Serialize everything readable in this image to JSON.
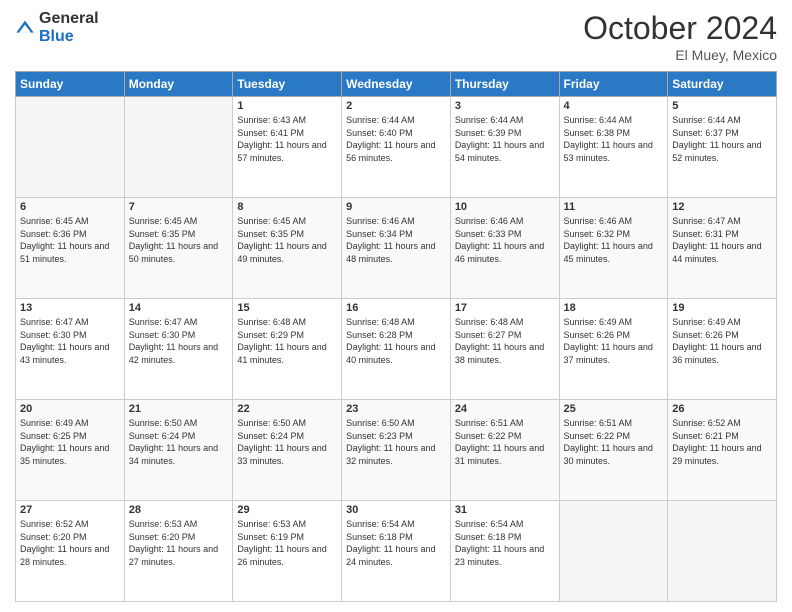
{
  "header": {
    "logo_general": "General",
    "logo_blue": "Blue",
    "month_title": "October 2024",
    "location": "El Muey, Mexico"
  },
  "days_of_week": [
    "Sunday",
    "Monday",
    "Tuesday",
    "Wednesday",
    "Thursday",
    "Friday",
    "Saturday"
  ],
  "weeks": [
    [
      {
        "num": "",
        "sunrise": "",
        "sunset": "",
        "daylight": ""
      },
      {
        "num": "",
        "sunrise": "",
        "sunset": "",
        "daylight": ""
      },
      {
        "num": "1",
        "sunrise": "Sunrise: 6:43 AM",
        "sunset": "Sunset: 6:41 PM",
        "daylight": "Daylight: 11 hours and 57 minutes."
      },
      {
        "num": "2",
        "sunrise": "Sunrise: 6:44 AM",
        "sunset": "Sunset: 6:40 PM",
        "daylight": "Daylight: 11 hours and 56 minutes."
      },
      {
        "num": "3",
        "sunrise": "Sunrise: 6:44 AM",
        "sunset": "Sunset: 6:39 PM",
        "daylight": "Daylight: 11 hours and 54 minutes."
      },
      {
        "num": "4",
        "sunrise": "Sunrise: 6:44 AM",
        "sunset": "Sunset: 6:38 PM",
        "daylight": "Daylight: 11 hours and 53 minutes."
      },
      {
        "num": "5",
        "sunrise": "Sunrise: 6:44 AM",
        "sunset": "Sunset: 6:37 PM",
        "daylight": "Daylight: 11 hours and 52 minutes."
      }
    ],
    [
      {
        "num": "6",
        "sunrise": "Sunrise: 6:45 AM",
        "sunset": "Sunset: 6:36 PM",
        "daylight": "Daylight: 11 hours and 51 minutes."
      },
      {
        "num": "7",
        "sunrise": "Sunrise: 6:45 AM",
        "sunset": "Sunset: 6:35 PM",
        "daylight": "Daylight: 11 hours and 50 minutes."
      },
      {
        "num": "8",
        "sunrise": "Sunrise: 6:45 AM",
        "sunset": "Sunset: 6:35 PM",
        "daylight": "Daylight: 11 hours and 49 minutes."
      },
      {
        "num": "9",
        "sunrise": "Sunrise: 6:46 AM",
        "sunset": "Sunset: 6:34 PM",
        "daylight": "Daylight: 11 hours and 48 minutes."
      },
      {
        "num": "10",
        "sunrise": "Sunrise: 6:46 AM",
        "sunset": "Sunset: 6:33 PM",
        "daylight": "Daylight: 11 hours and 46 minutes."
      },
      {
        "num": "11",
        "sunrise": "Sunrise: 6:46 AM",
        "sunset": "Sunset: 6:32 PM",
        "daylight": "Daylight: 11 hours and 45 minutes."
      },
      {
        "num": "12",
        "sunrise": "Sunrise: 6:47 AM",
        "sunset": "Sunset: 6:31 PM",
        "daylight": "Daylight: 11 hours and 44 minutes."
      }
    ],
    [
      {
        "num": "13",
        "sunrise": "Sunrise: 6:47 AM",
        "sunset": "Sunset: 6:30 PM",
        "daylight": "Daylight: 11 hours and 43 minutes."
      },
      {
        "num": "14",
        "sunrise": "Sunrise: 6:47 AM",
        "sunset": "Sunset: 6:30 PM",
        "daylight": "Daylight: 11 hours and 42 minutes."
      },
      {
        "num": "15",
        "sunrise": "Sunrise: 6:48 AM",
        "sunset": "Sunset: 6:29 PM",
        "daylight": "Daylight: 11 hours and 41 minutes."
      },
      {
        "num": "16",
        "sunrise": "Sunrise: 6:48 AM",
        "sunset": "Sunset: 6:28 PM",
        "daylight": "Daylight: 11 hours and 40 minutes."
      },
      {
        "num": "17",
        "sunrise": "Sunrise: 6:48 AM",
        "sunset": "Sunset: 6:27 PM",
        "daylight": "Daylight: 11 hours and 38 minutes."
      },
      {
        "num": "18",
        "sunrise": "Sunrise: 6:49 AM",
        "sunset": "Sunset: 6:26 PM",
        "daylight": "Daylight: 11 hours and 37 minutes."
      },
      {
        "num": "19",
        "sunrise": "Sunrise: 6:49 AM",
        "sunset": "Sunset: 6:26 PM",
        "daylight": "Daylight: 11 hours and 36 minutes."
      }
    ],
    [
      {
        "num": "20",
        "sunrise": "Sunrise: 6:49 AM",
        "sunset": "Sunset: 6:25 PM",
        "daylight": "Daylight: 11 hours and 35 minutes."
      },
      {
        "num": "21",
        "sunrise": "Sunrise: 6:50 AM",
        "sunset": "Sunset: 6:24 PM",
        "daylight": "Daylight: 11 hours and 34 minutes."
      },
      {
        "num": "22",
        "sunrise": "Sunrise: 6:50 AM",
        "sunset": "Sunset: 6:24 PM",
        "daylight": "Daylight: 11 hours and 33 minutes."
      },
      {
        "num": "23",
        "sunrise": "Sunrise: 6:50 AM",
        "sunset": "Sunset: 6:23 PM",
        "daylight": "Daylight: 11 hours and 32 minutes."
      },
      {
        "num": "24",
        "sunrise": "Sunrise: 6:51 AM",
        "sunset": "Sunset: 6:22 PM",
        "daylight": "Daylight: 11 hours and 31 minutes."
      },
      {
        "num": "25",
        "sunrise": "Sunrise: 6:51 AM",
        "sunset": "Sunset: 6:22 PM",
        "daylight": "Daylight: 11 hours and 30 minutes."
      },
      {
        "num": "26",
        "sunrise": "Sunrise: 6:52 AM",
        "sunset": "Sunset: 6:21 PM",
        "daylight": "Daylight: 11 hours and 29 minutes."
      }
    ],
    [
      {
        "num": "27",
        "sunrise": "Sunrise: 6:52 AM",
        "sunset": "Sunset: 6:20 PM",
        "daylight": "Daylight: 11 hours and 28 minutes."
      },
      {
        "num": "28",
        "sunrise": "Sunrise: 6:53 AM",
        "sunset": "Sunset: 6:20 PM",
        "daylight": "Daylight: 11 hours and 27 minutes."
      },
      {
        "num": "29",
        "sunrise": "Sunrise: 6:53 AM",
        "sunset": "Sunset: 6:19 PM",
        "daylight": "Daylight: 11 hours and 26 minutes."
      },
      {
        "num": "30",
        "sunrise": "Sunrise: 6:54 AM",
        "sunset": "Sunset: 6:18 PM",
        "daylight": "Daylight: 11 hours and 24 minutes."
      },
      {
        "num": "31",
        "sunrise": "Sunrise: 6:54 AM",
        "sunset": "Sunset: 6:18 PM",
        "daylight": "Daylight: 11 hours and 23 minutes."
      },
      {
        "num": "",
        "sunrise": "",
        "sunset": "",
        "daylight": ""
      },
      {
        "num": "",
        "sunrise": "",
        "sunset": "",
        "daylight": ""
      }
    ]
  ]
}
